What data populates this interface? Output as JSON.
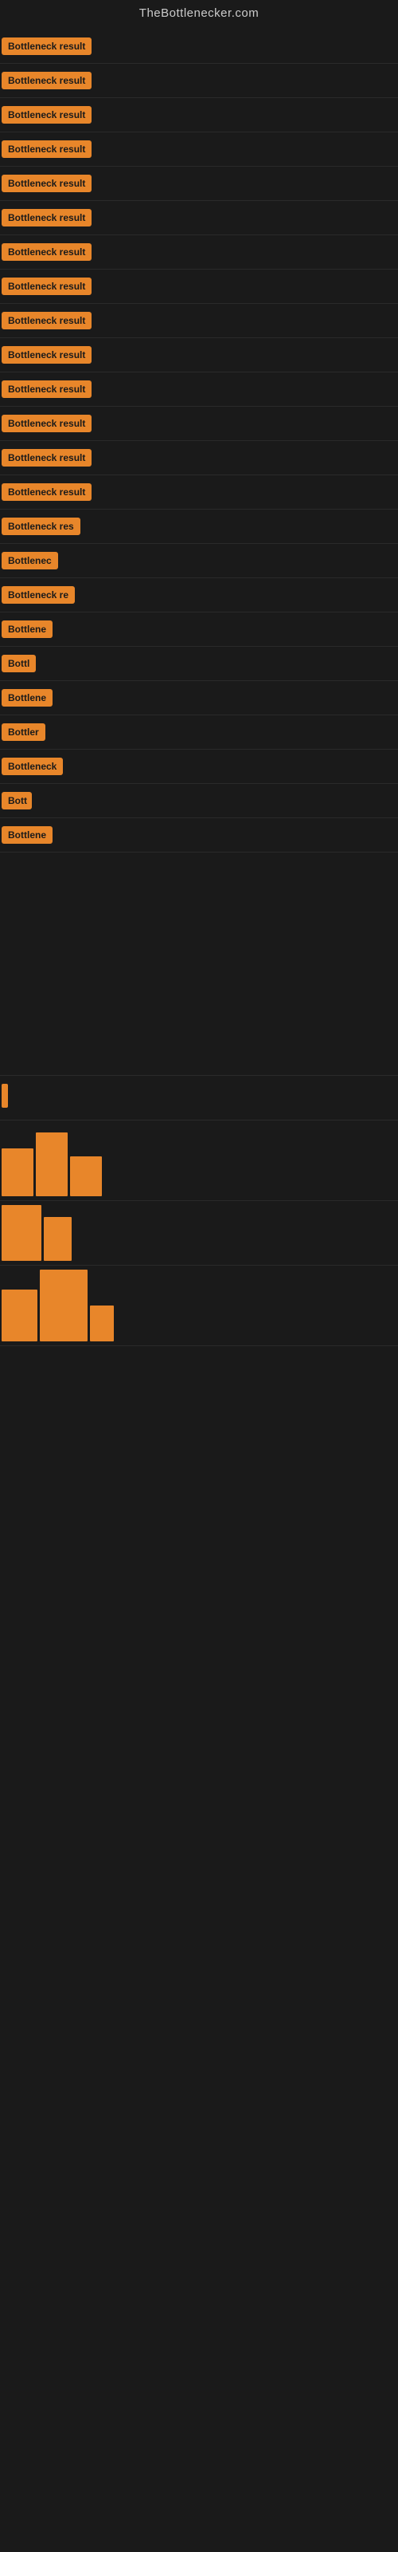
{
  "site": {
    "title": "TheBottlenecker.com"
  },
  "items": [
    {
      "label": "Bottleneck result",
      "width": 130
    },
    {
      "label": "Bottleneck result",
      "width": 130
    },
    {
      "label": "Bottleneck result",
      "width": 130
    },
    {
      "label": "Bottleneck result",
      "width": 130
    },
    {
      "label": "Bottleneck result",
      "width": 130
    },
    {
      "label": "Bottleneck result",
      "width": 130
    },
    {
      "label": "Bottleneck result",
      "width": 130
    },
    {
      "label": "Bottleneck result",
      "width": 130
    },
    {
      "label": "Bottleneck result",
      "width": 130
    },
    {
      "label": "Bottleneck result",
      "width": 130
    },
    {
      "label": "Bottleneck result",
      "width": 130
    },
    {
      "label": "Bottleneck result",
      "width": 130
    },
    {
      "label": "Bottleneck result",
      "width": 130
    },
    {
      "label": "Bottleneck result",
      "width": 130
    },
    {
      "label": "Bottleneck res",
      "width": 110
    },
    {
      "label": "Bottlenec",
      "width": 75
    },
    {
      "label": "Bottleneck re",
      "width": 95
    },
    {
      "label": "Bottlene",
      "width": 68
    },
    {
      "label": "Bottl",
      "width": 45
    },
    {
      "label": "Bottlene",
      "width": 68
    },
    {
      "label": "Bottler",
      "width": 58
    },
    {
      "label": "Bottleneck",
      "width": 80
    },
    {
      "label": "Bott",
      "width": 38
    },
    {
      "label": "Bottlene",
      "width": 68
    }
  ],
  "accent_color": "#e8862a",
  "bg_color": "#1a1a1a"
}
